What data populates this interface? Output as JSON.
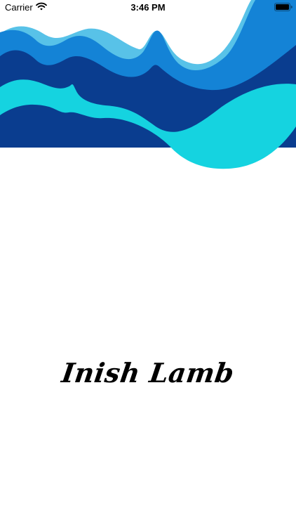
{
  "status_bar": {
    "carrier": "Carrier",
    "time": "3:46 PM",
    "wifi_icon": "wifi-icon",
    "battery_icon": "battery-icon"
  },
  "decoration": {
    "icon": "layered-waves-illustration",
    "colors": [
      "#58c2e8",
      "#1483d6",
      "#0a3d8f",
      "#15d3e0"
    ]
  },
  "app": {
    "title": "Inish Lamb"
  }
}
